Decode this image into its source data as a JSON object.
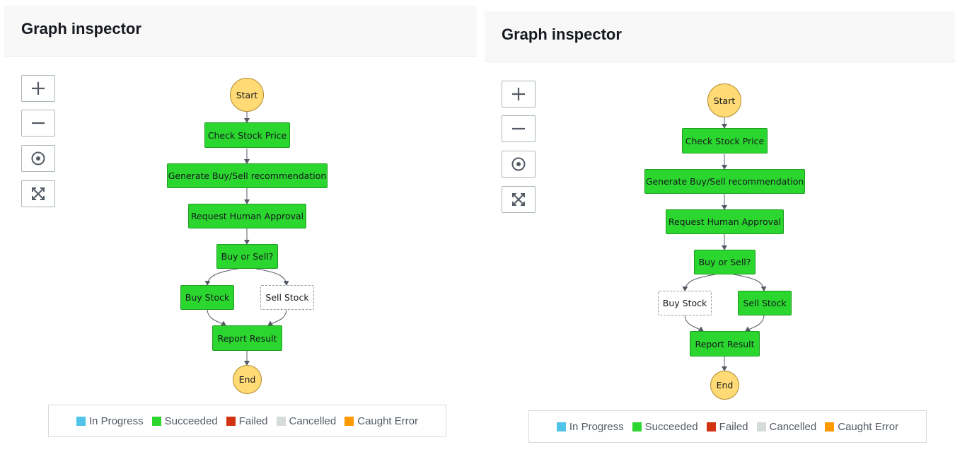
{
  "panels": [
    {
      "title": "Graph inspector",
      "controls": {
        "zoom_in": "zoom-in-icon",
        "zoom_out": "zoom-out-icon",
        "center": "center-icon",
        "fit": "fit-screen-icon"
      },
      "nodes": {
        "start": "Start",
        "check": "Check Stock Price",
        "generate": "Generate Buy/Sell recommendation",
        "approval": "Request Human Approval",
        "choice": "Buy or Sell?",
        "buy": "Buy Stock",
        "sell": "Sell Stock",
        "report": "Report Result",
        "end": "End"
      },
      "node_status": {
        "buy": "Succeeded",
        "sell": "Skipped"
      }
    },
    {
      "title": "Graph inspector",
      "controls": {
        "zoom_in": "zoom-in-icon",
        "zoom_out": "zoom-out-icon",
        "center": "center-icon",
        "fit": "fit-screen-icon"
      },
      "nodes": {
        "start": "Start",
        "check": "Check Stock Price",
        "generate": "Generate Buy/Sell recommendation",
        "approval": "Request Human Approval",
        "choice": "Buy or Sell?",
        "buy": "Buy Stock",
        "sell": "Sell Stock",
        "report": "Report Result",
        "end": "End"
      },
      "node_status": {
        "buy": "Skipped",
        "sell": "Succeeded"
      }
    }
  ],
  "legend": [
    {
      "label": "In Progress",
      "color": "#4fc3e8"
    },
    {
      "label": "Succeeded",
      "color": "#2bd62e"
    },
    {
      "label": "Failed",
      "color": "#d13212"
    },
    {
      "label": "Cancelled",
      "color": "#d5dbdb"
    },
    {
      "label": "Caught Error",
      "color": "#ff9900"
    }
  ],
  "colors": {
    "succeeded": "#2bd62e",
    "terminal": "#ffda75",
    "edge": "#545b64"
  }
}
